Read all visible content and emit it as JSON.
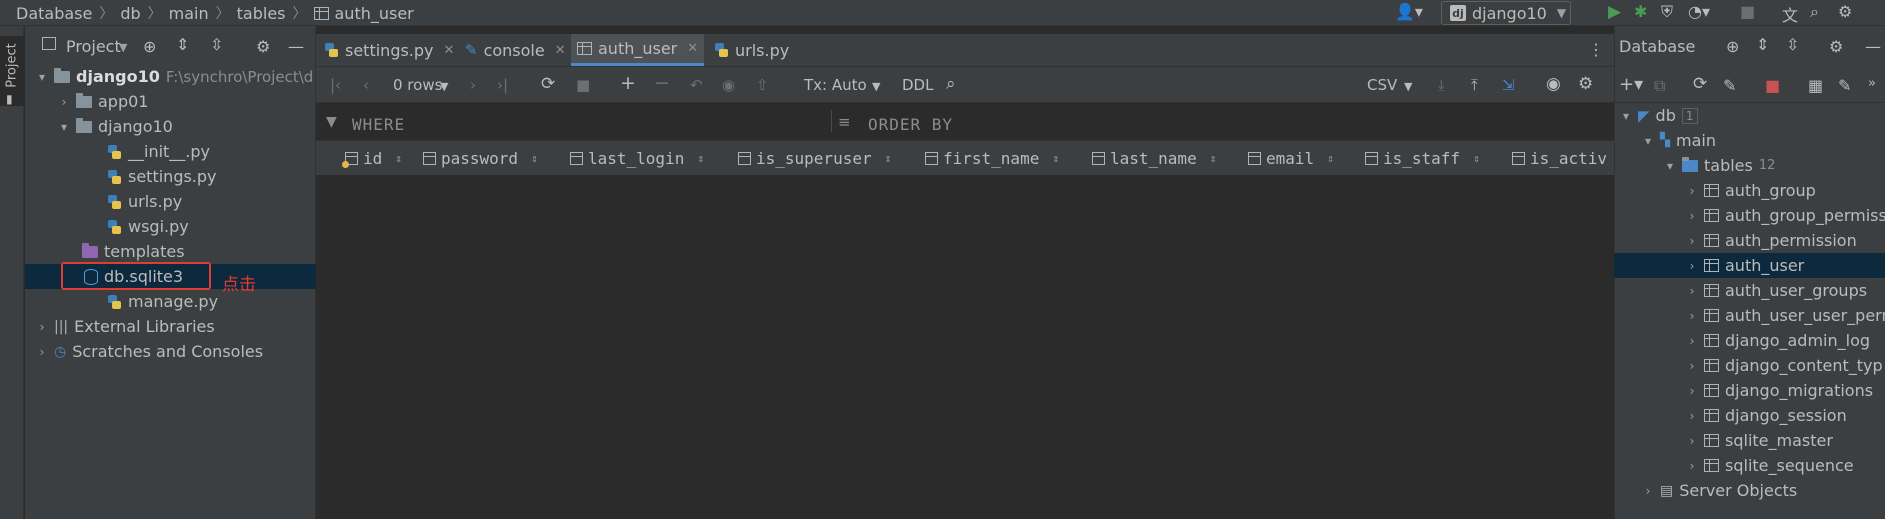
{
  "breadcrumb": [
    "Database",
    "db",
    "main",
    "tables",
    "auth_user"
  ],
  "run_config": {
    "label": "django10"
  },
  "project_panel": {
    "stripe_label": "Project",
    "header_label": "Project",
    "tree": [
      {
        "label": "django10",
        "path": "F:\\synchro\\Project\\d"
      },
      {
        "label": "app01"
      },
      {
        "label": "django10"
      },
      {
        "label": "__init__.py"
      },
      {
        "label": "settings.py"
      },
      {
        "label": "urls.py"
      },
      {
        "label": "wsgi.py"
      },
      {
        "label": "templates"
      },
      {
        "label": "db.sqlite3"
      },
      {
        "label": "manage.py"
      },
      {
        "label": "External Libraries"
      },
      {
        "label": "Scratches and Consoles"
      }
    ]
  },
  "annotation": "点击",
  "tabs": [
    {
      "label": "settings.py"
    },
    {
      "label": "console"
    },
    {
      "label": "auth_user"
    },
    {
      "label": "urls.py"
    }
  ],
  "grid_toolbar": {
    "rows": "0 rows",
    "tx": "Tx: Auto",
    "ddl": "DDL",
    "export": "CSV"
  },
  "filter": {
    "where": "WHERE",
    "order_by": "ORDER BY"
  },
  "columns": [
    "id",
    "password",
    "last_login",
    "is_superuser",
    "first_name",
    "last_name",
    "email",
    "is_staff",
    "is_activ"
  ],
  "db_panel": {
    "title": "Database",
    "db": {
      "label": "db",
      "count": "1"
    },
    "schema": "main",
    "tables_label": "tables",
    "tables_count": "12",
    "tables": [
      "auth_group",
      "auth_group_permiss",
      "auth_permission",
      "auth_user",
      "auth_user_groups",
      "auth_user_user_perm",
      "django_admin_log",
      "django_content_typ",
      "django_migrations",
      "django_session",
      "sqlite_master",
      "sqlite_sequence"
    ],
    "server_objects": "Server Objects"
  }
}
